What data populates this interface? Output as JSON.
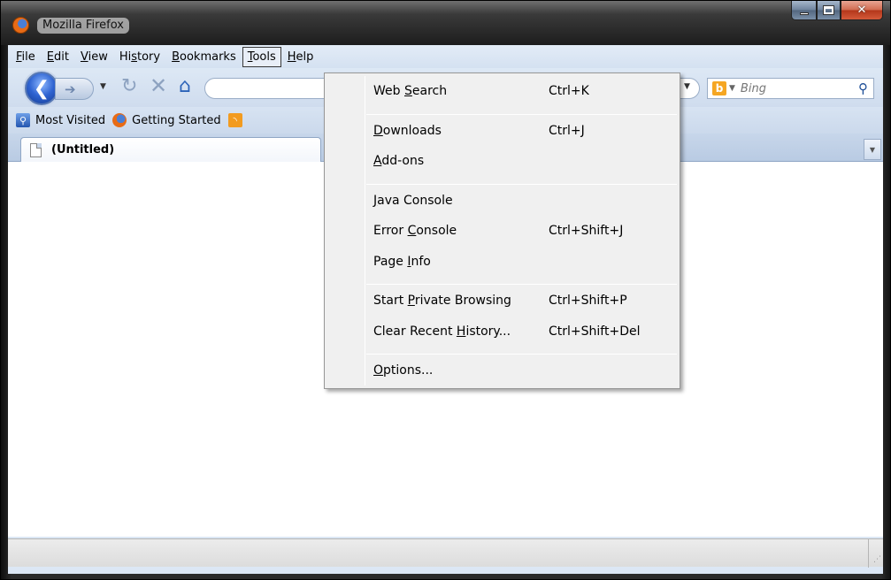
{
  "window": {
    "title": "Mozilla Firefox"
  },
  "menubar": {
    "items": [
      {
        "label": "File",
        "ul_index": 0
      },
      {
        "label": "Edit",
        "ul_index": 0
      },
      {
        "label": "View",
        "ul_index": 0
      },
      {
        "label": "History",
        "ul_index": 2
      },
      {
        "label": "Bookmarks",
        "ul_index": 0
      },
      {
        "label": "Tools",
        "ul_index": 0,
        "active": true
      },
      {
        "label": "Help",
        "ul_index": 0
      }
    ]
  },
  "search": {
    "placeholder": "Bing",
    "engine_icon": "bing-icon"
  },
  "bookmarks": [
    {
      "label": "Most Visited",
      "icon": "most-visited-icon"
    },
    {
      "label": "Getting Started",
      "icon": "firefox-icon"
    }
  ],
  "tab": {
    "title": "(Untitled)"
  },
  "tools_menu": {
    "groups": [
      [
        {
          "label": "Web Search",
          "ul_index": 4,
          "shortcut": "Ctrl+K"
        }
      ],
      [
        {
          "label": "Downloads",
          "ul_index": 0,
          "shortcut": "Ctrl+J"
        },
        {
          "label": "Add-ons",
          "ul_index": 0,
          "shortcut": ""
        }
      ],
      [
        {
          "label": "Java Console",
          "ul_index": 0,
          "shortcut": ""
        },
        {
          "label": "Error Console",
          "ul_index": 6,
          "shortcut": "Ctrl+Shift+J"
        },
        {
          "label": "Page Info",
          "ul_index": 5,
          "shortcut": ""
        }
      ],
      [
        {
          "label": "Start Private Browsing",
          "ul_index": 6,
          "shortcut": "Ctrl+Shift+P"
        },
        {
          "label": "Clear Recent History...",
          "ul_index": 13,
          "shortcut": "Ctrl+Shift+Del"
        }
      ],
      [
        {
          "label": "Options...",
          "ul_index": 0,
          "shortcut": ""
        }
      ]
    ]
  },
  "colors": {
    "menu_bg": "#f0f0f0",
    "accent": "#2e63d1"
  }
}
